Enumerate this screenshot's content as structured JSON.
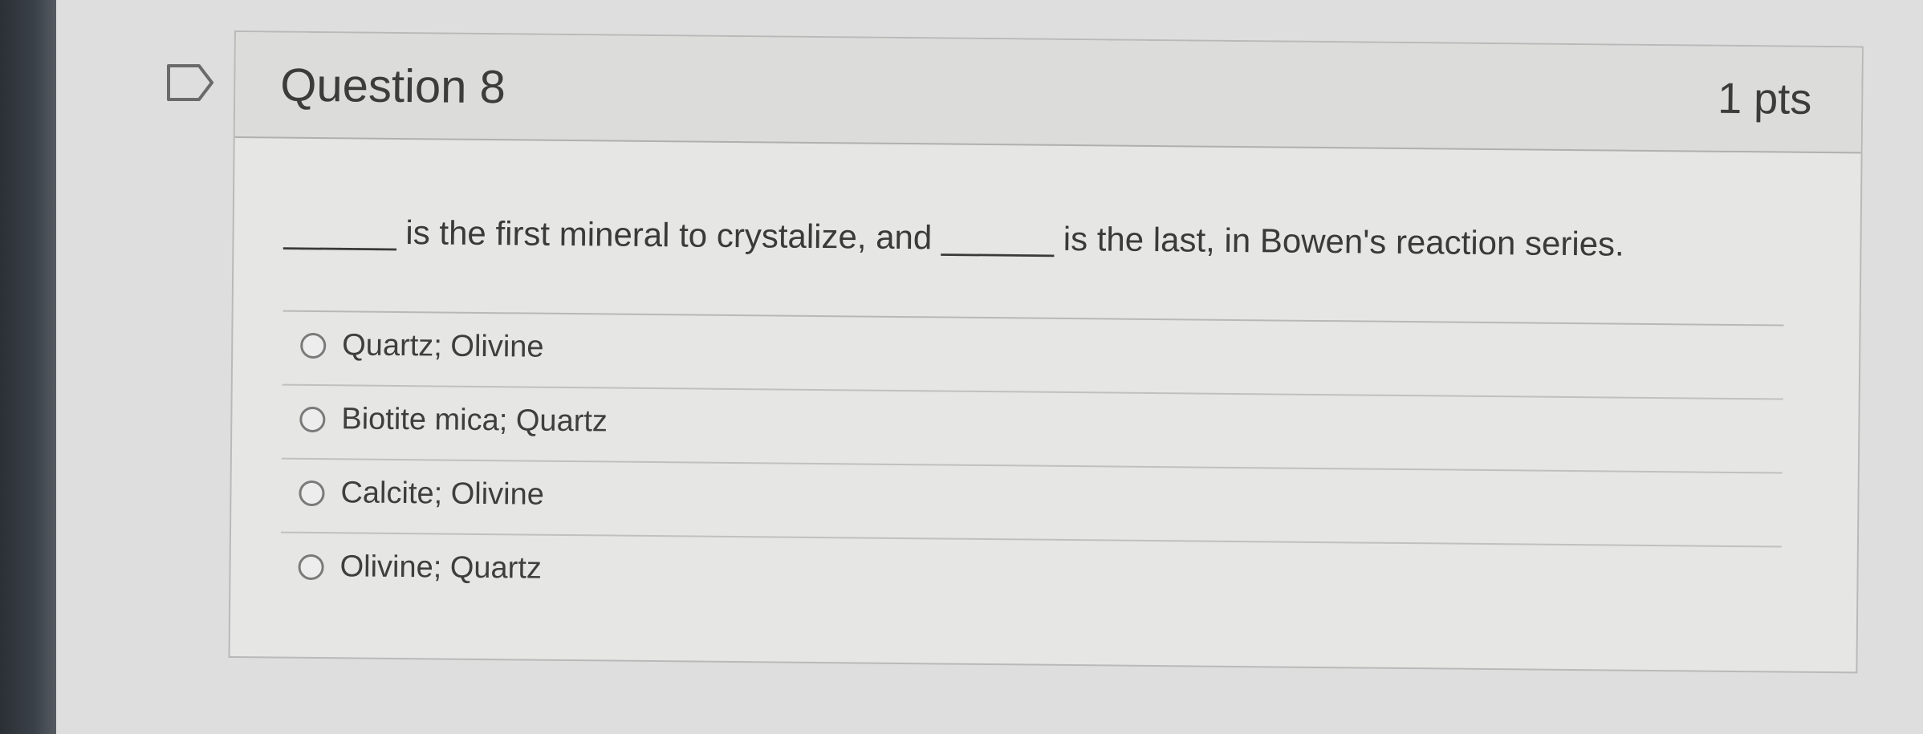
{
  "question": {
    "title": "Question 8",
    "points": "1 pts",
    "text": "______ is the first mineral to crystalize, and ______ is the last, in Bowen's reaction series.",
    "flag_icon": "flag-outline-icon"
  },
  "answers": [
    {
      "label": "Quartz; Olivine"
    },
    {
      "label": "Biotite mica; Quartz"
    },
    {
      "label": "Calcite; Olivine"
    },
    {
      "label": "Olivine; Quartz"
    }
  ]
}
